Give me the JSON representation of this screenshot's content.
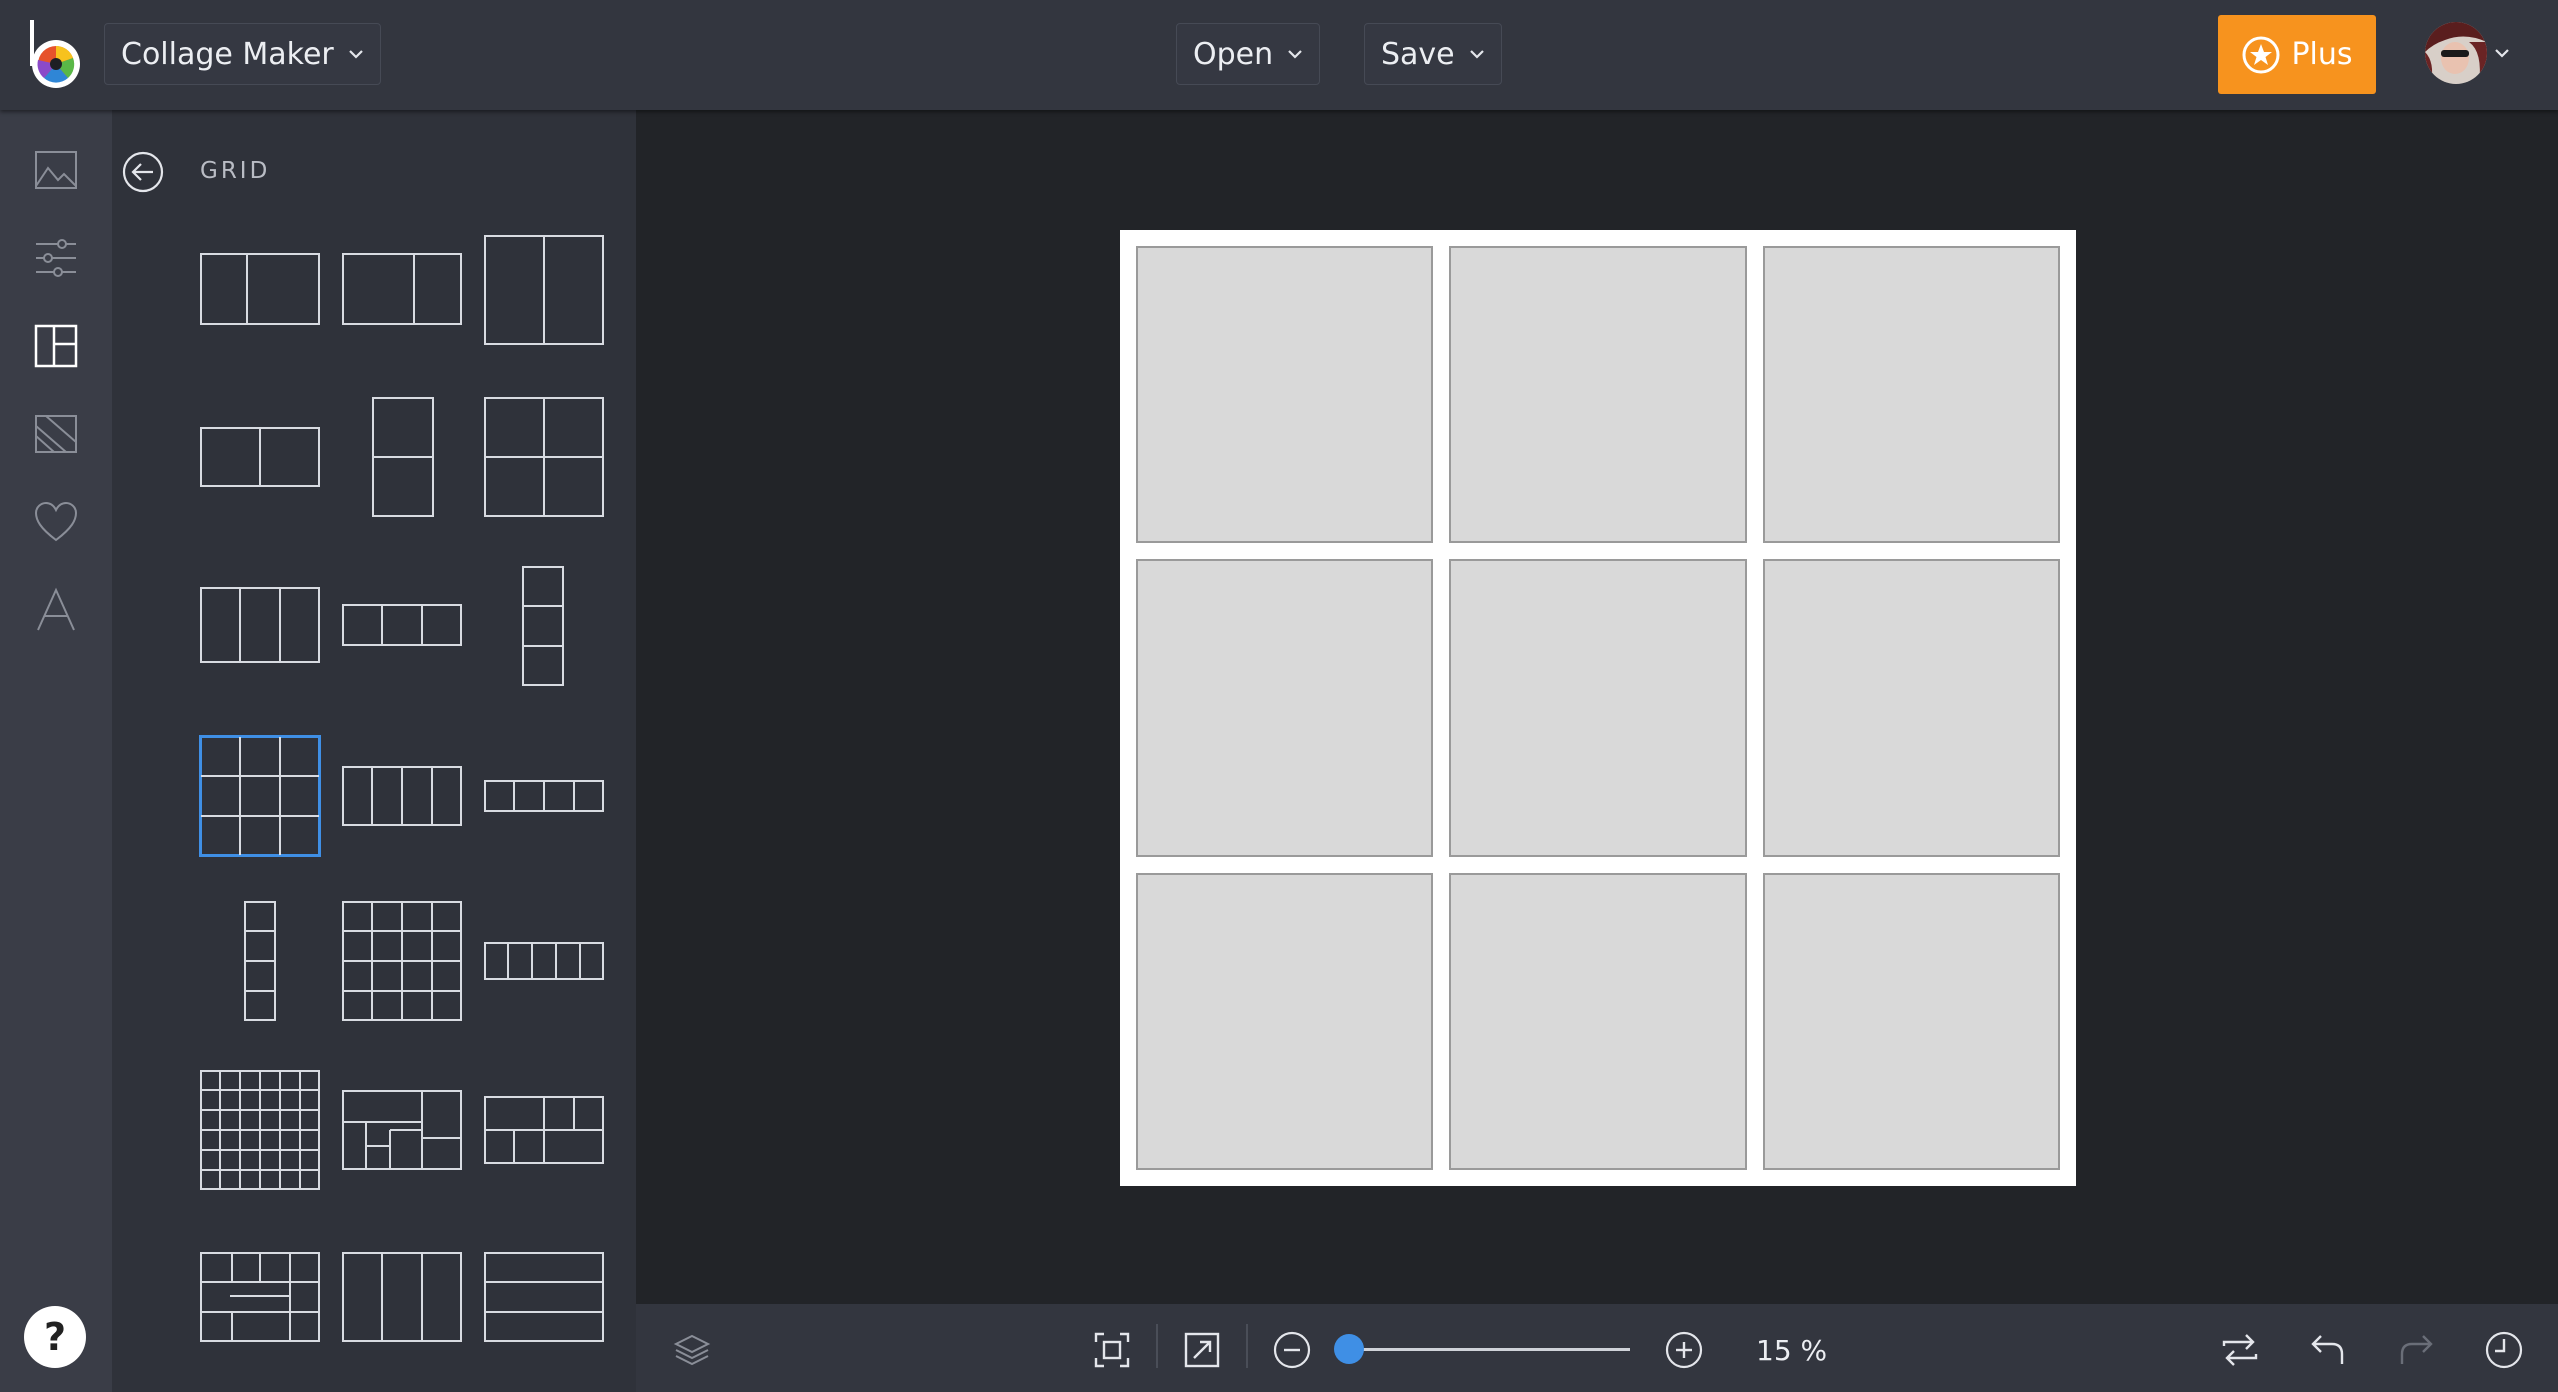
{
  "header": {
    "app_menu_label": "Collage Maker",
    "open_label": "Open",
    "save_label": "Save",
    "plus_label": "Plus"
  },
  "colors": {
    "accent": "#f7931e",
    "selection": "#3f8fe5",
    "toolbar_bg": "#33363f",
    "workspace_bg": "#222428",
    "cell_fill": "#d9d9d9"
  },
  "sidebar": {
    "rail_icons": [
      "image-icon",
      "adjust-sliders-icon",
      "layout-icon",
      "background-icon",
      "heart-icon",
      "text-icon"
    ],
    "active_rail_icon": "layout-icon",
    "help_label": "?"
  },
  "panel": {
    "title": "GRID",
    "selected_layout": "3x3 grid"
  },
  "canvas": {
    "grid_rows": 3,
    "grid_cols": 3
  },
  "zoom": {
    "percent_label": "15 %",
    "value_percent": 15
  }
}
